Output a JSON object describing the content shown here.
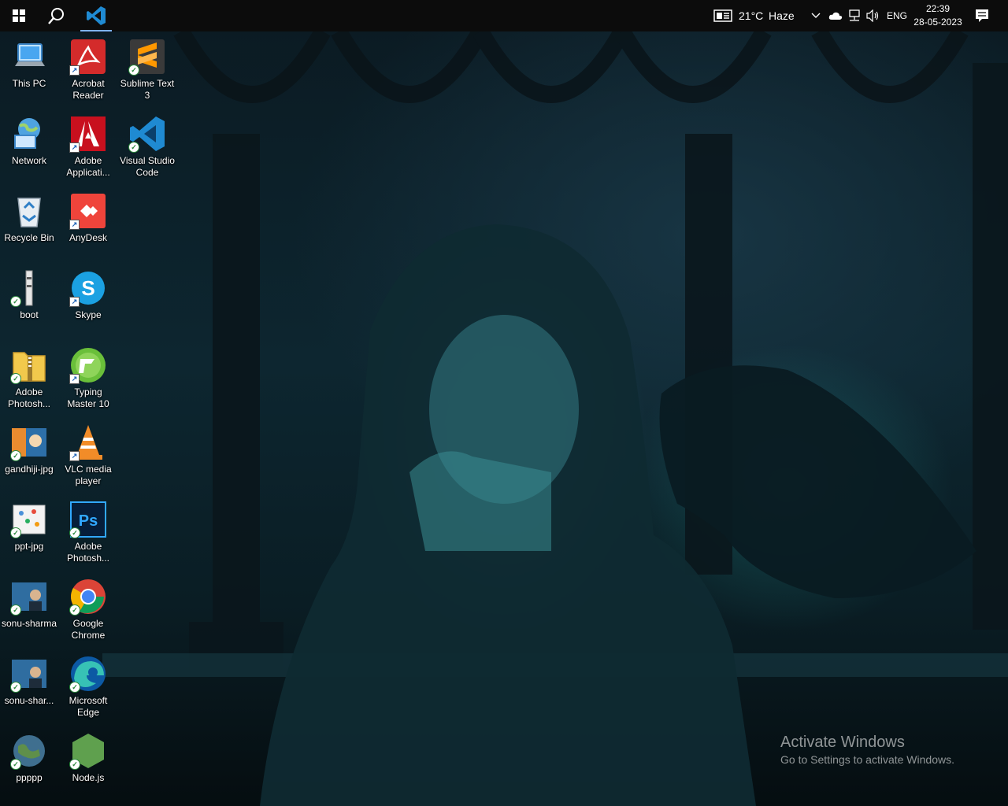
{
  "taskbar": {
    "weather": {
      "temp": "21°C",
      "condition": "Haze"
    },
    "language": "ENG",
    "clock": {
      "time": "22:39",
      "date": "28-05-2023"
    }
  },
  "desktop": {
    "icons": [
      {
        "label": "This PC",
        "icon": "this-pc-icon"
      },
      {
        "label": "Acrobat\nReader",
        "icon": "acrobat-reader-icon"
      },
      {
        "label": "Sublime Text\n3",
        "icon": "sublime-text-icon"
      },
      {
        "label": "Network",
        "icon": "network-icon"
      },
      {
        "label": "Adobe\nApplicati...",
        "icon": "adobe-applications-icon"
      },
      {
        "label": "Visual Studio\nCode",
        "icon": "vscode-icon"
      },
      {
        "label": "Recycle Bin",
        "icon": "recycle-bin-icon"
      },
      {
        "label": "AnyDesk",
        "icon": "anydesk-icon"
      },
      {
        "label": "boot",
        "icon": "boot-file-icon"
      },
      {
        "label": "Skype",
        "icon": "skype-icon"
      },
      {
        "label": "Adobe\nPhotosh...",
        "icon": "zip-folder-icon"
      },
      {
        "label": "Typing\nMaster 10",
        "icon": "typing-master-icon"
      },
      {
        "label": "gandhiji-jpg",
        "icon": "image-file-icon"
      },
      {
        "label": "VLC media\nplayer",
        "icon": "vlc-icon"
      },
      {
        "label": "ppt-jpg",
        "icon": "image-file-icon"
      },
      {
        "label": "Adobe\nPhotosh...",
        "icon": "photoshop-icon"
      },
      {
        "label": "sonu-sharma",
        "icon": "image-file-icon"
      },
      {
        "label": "Google\nChrome",
        "icon": "chrome-icon"
      },
      {
        "label": "sonu-shar...",
        "icon": "image-file-icon"
      },
      {
        "label": "Microsoft\nEdge",
        "icon": "edge-icon"
      },
      {
        "label": "ppppp",
        "icon": "globe-file-icon"
      },
      {
        "label": "Node.js",
        "icon": "nodejs-icon"
      }
    ]
  },
  "watermark": {
    "title": "Activate Windows",
    "subtitle": "Go to Settings to activate Windows."
  }
}
